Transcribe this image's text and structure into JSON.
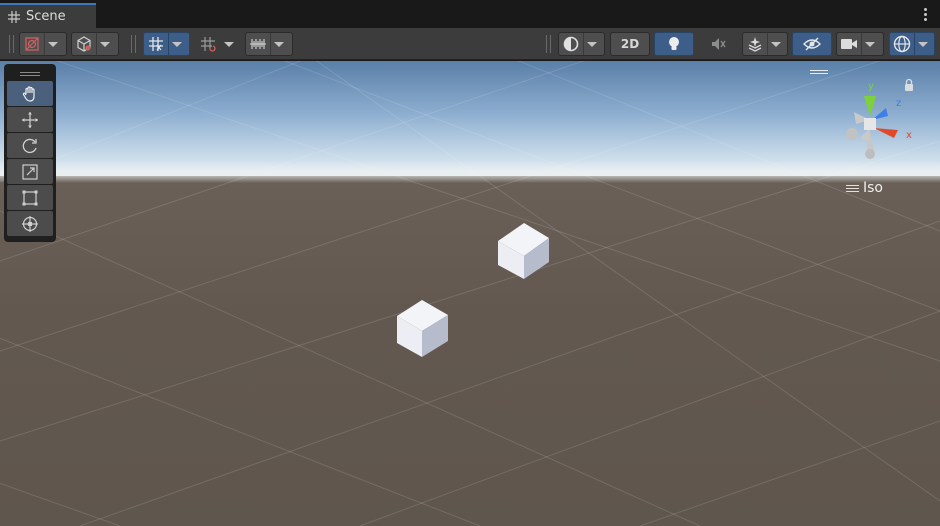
{
  "tab": {
    "title": "Scene",
    "icon": "grid-icon",
    "menu_icon": "more-vertical-icon"
  },
  "toolbar": {
    "left": [
      {
        "name": "draw-mode",
        "icon": "shading-mode-icon",
        "dropdown": true
      },
      {
        "name": "render-mode",
        "icon": "cube-mode-icon",
        "dropdown": true
      },
      {
        "name": "grid-snap",
        "icon": "grid-snapping-icon",
        "dropdown": true,
        "active": true
      },
      {
        "name": "increment-snap",
        "icon": "increment-snap-icon",
        "dropdown": true
      },
      {
        "name": "align-grid",
        "icon": "align-grid-icon",
        "dropdown": true
      }
    ],
    "right": [
      {
        "name": "scene-view-mode",
        "icon": "sphere-shading-icon",
        "dropdown": true
      },
      {
        "name": "2d-toggle",
        "label": "2D"
      },
      {
        "name": "lighting-toggle",
        "icon": "lightbulb-icon",
        "active": true
      },
      {
        "name": "audio-toggle",
        "icon": "audio-mute-icon"
      },
      {
        "name": "effects",
        "icon": "effects-icon",
        "dropdown": true
      },
      {
        "name": "hidden-objects",
        "icon": "visibility-off-icon",
        "active": true
      },
      {
        "name": "camera",
        "icon": "camera-icon",
        "dropdown": true
      },
      {
        "name": "gizmos",
        "icon": "gizmo-sphere-icon",
        "dropdown": true,
        "active": true
      }
    ],
    "two_d_label": "2D"
  },
  "tools": [
    {
      "name": "hand-tool",
      "icon": "hand-icon",
      "active": true
    },
    {
      "name": "move-tool",
      "icon": "move-arrows-icon"
    },
    {
      "name": "rotate-tool",
      "icon": "rotate-icon"
    },
    {
      "name": "scale-tool",
      "icon": "scale-icon"
    },
    {
      "name": "rect-tool",
      "icon": "rect-transform-icon"
    },
    {
      "name": "transform-tool",
      "icon": "transform-icon"
    }
  ],
  "gizmo": {
    "axes": {
      "x": "x",
      "y": "y",
      "z": "z"
    },
    "projection": "Iso"
  },
  "colors": {
    "accent": "#3d5e88",
    "axis_x": "#e04a2a",
    "axis_y": "#7ed13a",
    "axis_z": "#3f7fe8",
    "sky": "#8cadcf",
    "ground": "#625850"
  }
}
